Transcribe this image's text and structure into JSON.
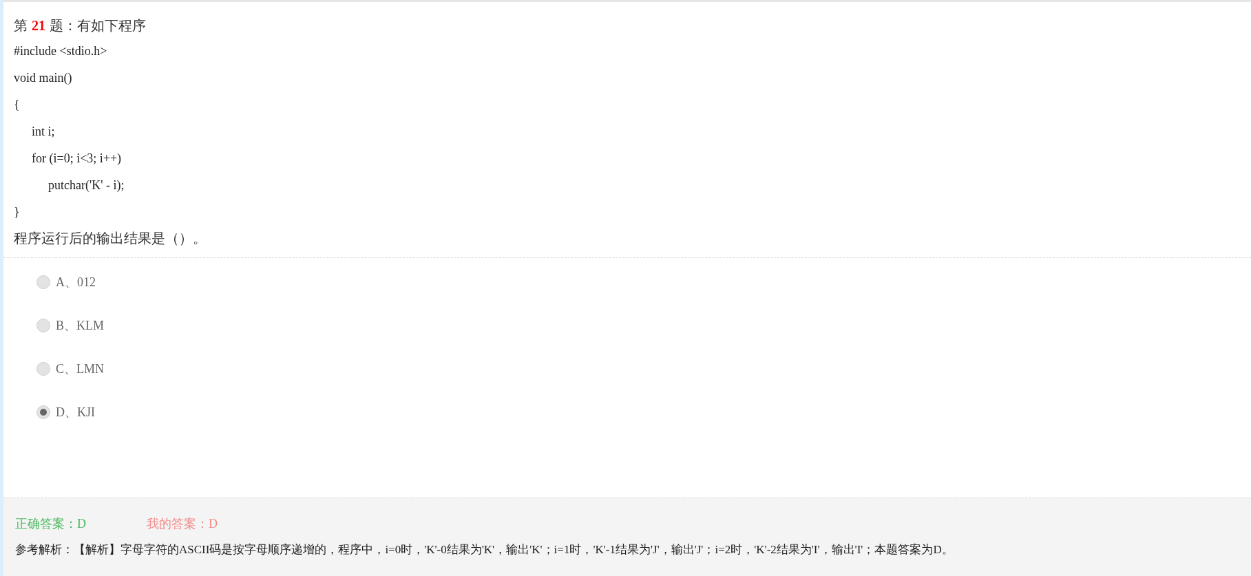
{
  "question": {
    "prefix": "第",
    "number": "21",
    "suffix": "题：有如下程序",
    "code": [
      {
        "text": "#include <stdio.h>"
      },
      {
        "text": "void main()"
      },
      {
        "text": "{",
        "children": [
          {
            "text": "int i;"
          },
          {
            "text": "for (i=0; i<3; i++)",
            "children": [
              {
                "text": "putchar('K' - i);"
              }
            ]
          }
        ]
      },
      {
        "text": "}"
      }
    ],
    "prompt": "程序运行后的输出结果是（）。"
  },
  "options": [
    {
      "label": "A、012",
      "selected": false
    },
    {
      "label": "B、KLM",
      "selected": false
    },
    {
      "label": "C、LMN",
      "selected": false
    },
    {
      "label": "D、KJI",
      "selected": true
    }
  ],
  "result": {
    "correct": "正确答案：D",
    "mine": "我的答案：D",
    "analysis": "参考解析：【解析】字母字符的ASCII码是按字母顺序递增的，程序中，i=0时，'K'-0结果为'K'，输出'K'；i=1时，'K'-1结果为'J'，输出'J'；i=2时，'K'-2结果为'I'，输出'I'；本题答案为D。"
  }
}
